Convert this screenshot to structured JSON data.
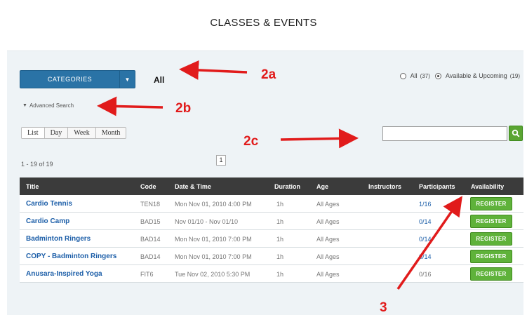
{
  "page_title": "CLASSES & EVENTS",
  "filters": {
    "categories_label": "CATEGORIES",
    "selected_category": "All",
    "radio_all_label": "All",
    "radio_all_count": "(37)",
    "radio_available_label": "Available & Upcoming",
    "radio_available_count": "(19)",
    "advanced_search_label": "Advanced Search",
    "search_value": ""
  },
  "view_tabs": [
    "List",
    "Day",
    "Week",
    "Month"
  ],
  "pagination": {
    "results_text": "1 - 19 of 19",
    "current_page": "1"
  },
  "table": {
    "headers": [
      "Title",
      "Code",
      "Date & Time",
      "Duration",
      "Age",
      "Instructors",
      "Participants",
      "Availability"
    ],
    "rows": [
      {
        "title": "Cardio Tennis",
        "code": "TEN18",
        "datetime": "Mon Nov 01, 2010 4:00 PM",
        "duration": "1h",
        "age": "All Ages",
        "instructors": "",
        "participants": "1/16",
        "action": "REGISTER"
      },
      {
        "title": "Cardio Camp",
        "code": "BAD15",
        "datetime": "Nov 01/10 - Nov 01/10",
        "duration": "1h",
        "age": "All Ages",
        "instructors": "",
        "participants": "0/14",
        "action": "REGISTER"
      },
      {
        "title": "Badminton Ringers",
        "code": "BAD14",
        "datetime": "Mon Nov 01, 2010 7:00 PM",
        "duration": "1h",
        "age": "All Ages",
        "instructors": "",
        "participants": "0/14",
        "action": "REGISTER"
      },
      {
        "title": "COPY - Badminton Ringers",
        "code": "BAD14",
        "datetime": "Mon Nov 01, 2010 7:00 PM",
        "duration": "1h",
        "age": "All Ages",
        "instructors": "",
        "participants": "0/14",
        "action": "REGISTER"
      },
      {
        "title": "Anusara-Inspired Yoga",
        "code": "FIT6",
        "datetime": "Tue Nov 02, 2010 5:30 PM",
        "duration": "1h",
        "age": "All Ages",
        "instructors": "",
        "participants": "0/16",
        "action": "REGISTER"
      }
    ]
  },
  "annotations": {
    "a": "2a",
    "b": "2b",
    "c": "2c",
    "d": "3"
  },
  "colors": {
    "annotation": "#e11b1b",
    "header_bg": "#3b3b3b",
    "register_bg": "#5fb23a",
    "categories_bg": "#2a73a6",
    "link": "#1c5ea8"
  }
}
